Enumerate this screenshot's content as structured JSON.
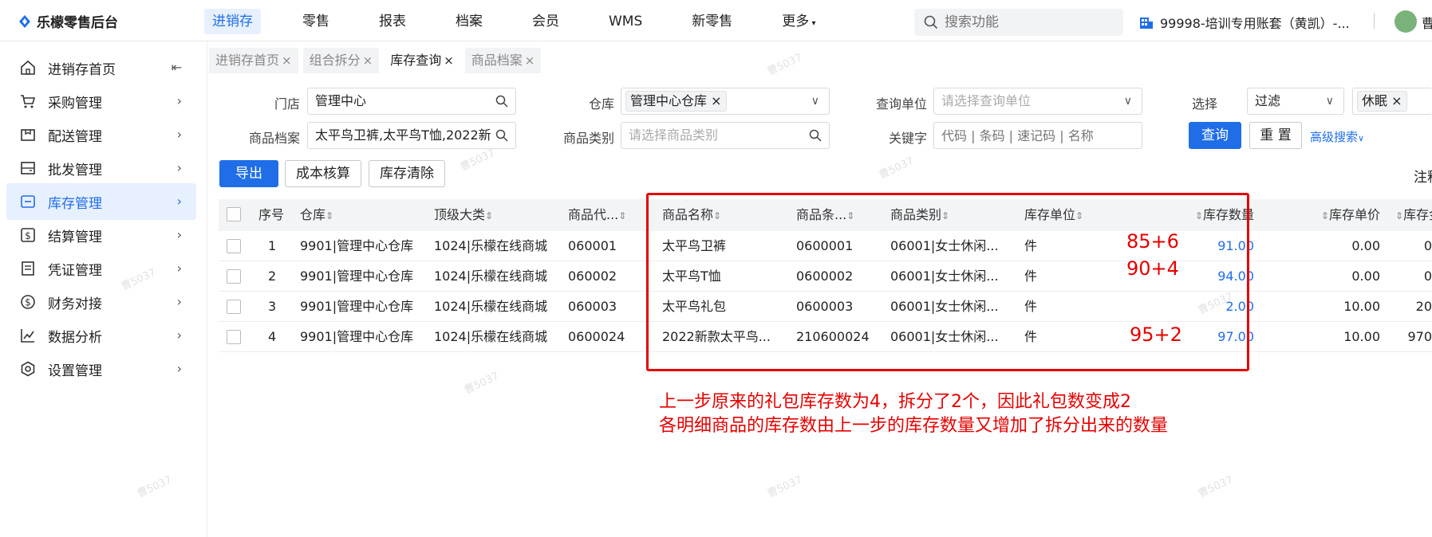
{
  "app": {
    "title": "乐檬零售后台"
  },
  "topnav": [
    {
      "label": "进销存",
      "active": true
    },
    {
      "label": "零售"
    },
    {
      "label": "报表"
    },
    {
      "label": "档案"
    },
    {
      "label": "会员"
    },
    {
      "label": "WMS"
    },
    {
      "label": "新零售"
    },
    {
      "label": "更多"
    }
  ],
  "search": {
    "placeholder": "搜索功能"
  },
  "account": {
    "name": "99998-培训专用账套（黄凯）-...",
    "user": "曹"
  },
  "sidebar": [
    {
      "label": "进销存首页",
      "icon": "home-icon"
    },
    {
      "label": "采购管理",
      "icon": "cart-icon"
    },
    {
      "label": "配送管理",
      "icon": "delivery-icon"
    },
    {
      "label": "批发管理",
      "icon": "wallet-icon"
    },
    {
      "label": "库存管理",
      "icon": "inventory-icon",
      "active": true
    },
    {
      "label": "结算管理",
      "icon": "settlement-icon"
    },
    {
      "label": "凭证管理",
      "icon": "voucher-icon"
    },
    {
      "label": "财务对接",
      "icon": "finance-icon"
    },
    {
      "label": "数据分析",
      "icon": "chart-icon"
    },
    {
      "label": "设置管理",
      "icon": "settings-icon"
    }
  ],
  "tabs": [
    {
      "label": "进销存首页"
    },
    {
      "label": "组合拆分"
    },
    {
      "label": "库存查询",
      "active": true
    },
    {
      "label": "商品档案"
    }
  ],
  "filters": {
    "store_label": "门店",
    "store_value": "管理中心",
    "warehouse_label": "仓库",
    "warehouse_value": "管理中心仓库",
    "unit_label": "查询单位",
    "unit_placeholder": "请选择查询单位",
    "select_label": "选择",
    "select_value": "过滤",
    "select_chip": "休眠",
    "product_label": "商品档案",
    "product_value": "太平鸟卫裤,太平鸟T恤,2022新",
    "category_label": "商品类别",
    "category_placeholder": "请选择商品类别",
    "keyword_label": "关键字",
    "keyword_placeholder": "代码 | 条码 | 速记码 | 名称",
    "query_button": "查询",
    "reset_button": "重 置",
    "advanced_link": "高级搜索"
  },
  "actions": {
    "export": "导出",
    "cost": "成本核算",
    "clear": "库存清除",
    "note_right": "注释"
  },
  "table": {
    "headers": [
      "序号",
      "仓库",
      "顶级大类",
      "商品代...",
      "商品名称",
      "商品条...",
      "商品类别",
      "库存单位",
      "库存数量",
      "库存单价",
      "库存金"
    ],
    "rows": [
      {
        "no": "1",
        "warehouse": "9901|管理中心仓库",
        "top": "1024|乐檬在线商城",
        "code": "060001",
        "name": "太平鸟卫裤",
        "barcode": "0600001",
        "category": "06001|女士休闲...",
        "unit": "件",
        "qty": "91.00",
        "price": "0.00",
        "amount": "0"
      },
      {
        "no": "2",
        "warehouse": "9901|管理中心仓库",
        "top": "1024|乐檬在线商城",
        "code": "060002",
        "name": "太平鸟T恤",
        "barcode": "0600002",
        "category": "06001|女士休闲...",
        "unit": "件",
        "qty": "94.00",
        "price": "0.00",
        "amount": "0"
      },
      {
        "no": "3",
        "warehouse": "9901|管理中心仓库",
        "top": "1024|乐檬在线商城",
        "code": "060003",
        "name": "太平鸟礼包",
        "barcode": "0600003",
        "category": "06001|女士休闲...",
        "unit": "件",
        "qty": "2.00",
        "price": "10.00",
        "amount": "20"
      },
      {
        "no": "4",
        "warehouse": "9901|管理中心仓库",
        "top": "1024|乐檬在线商城",
        "code": "0600024",
        "name": "2022新款太平鸟...",
        "barcode": "210600024",
        "category": "06001|女士休闲...",
        "unit": "件",
        "qty": "97.00",
        "price": "10.00",
        "amount": "970"
      }
    ]
  },
  "annotations": {
    "a1": "85+6",
    "a2": "90+4",
    "a3": "95+2",
    "note1": "上一步原来的礼包库存数为4，拆分了2个，因此礼包数变成2",
    "note2": "各明细商品的库存数由上一步的库存数量又增加了拆分出来的数量"
  },
  "watermark": "曹5037",
  "colors": {
    "accent": "#1f6ee8",
    "annotation": "#e60000"
  }
}
